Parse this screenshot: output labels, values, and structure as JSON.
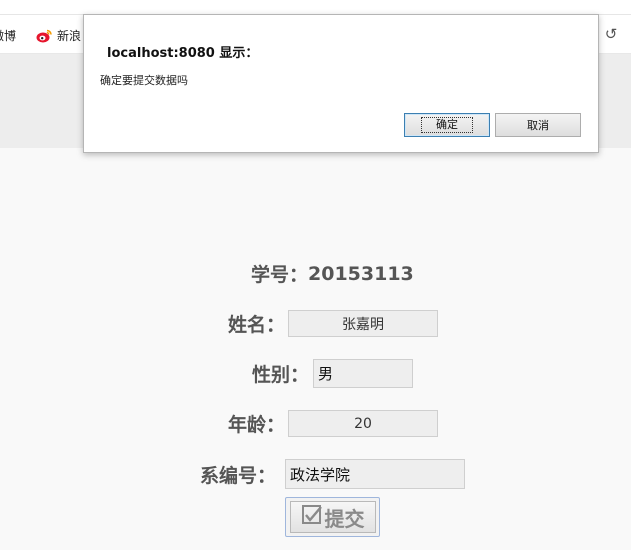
{
  "browser": {
    "bookmarks": [
      {
        "label": "微博"
      },
      {
        "label": "新浪"
      }
    ],
    "right_icon": "↺"
  },
  "form": {
    "student_id_label": "学号：",
    "student_id_value": "20153113",
    "name_label": "姓名：",
    "name_value": "张嘉明",
    "gender_label": "性别：",
    "gender_value": "男",
    "age_label": "年龄：",
    "age_value": "20",
    "dept_label": "系编号：",
    "dept_value": "政法学院",
    "submit_label": "提交"
  },
  "dialog": {
    "title": "localhost:8080 显示：",
    "message": "确定要提交数据吗",
    "ok_label": "确定",
    "cancel_label": "取消"
  },
  "colors": {
    "page_bg": "#f9f9f9",
    "field_bg": "#eeeeee",
    "ok_border": "#3c7fb1"
  }
}
